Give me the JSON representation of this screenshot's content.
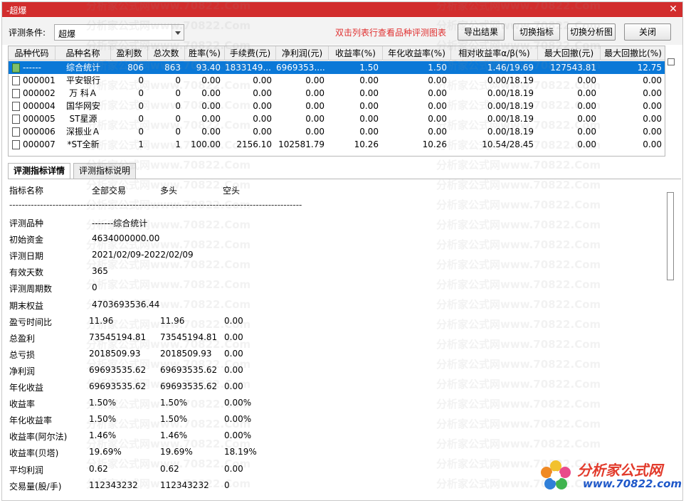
{
  "window": {
    "title": "-超爆",
    "close_label": "✕"
  },
  "toolbar": {
    "condition_label": "评测条件:",
    "condition_value": "超爆",
    "hint": "双击列表行查看品种评测图表",
    "buttons": [
      "导出结果",
      "切换指标",
      "切换分析图",
      "关闭"
    ]
  },
  "grid": {
    "columns": [
      "品种代码",
      "品种名称",
      "盈利数",
      "总次数",
      "胜率(%)",
      "手续费(元)",
      "净利润(元)",
      "收益率(%)",
      "年化收益率(%)",
      "相对收益率α/β(%)",
      "最大回撤(元)",
      "最大回撤比(%)"
    ],
    "rows": [
      [
        "------",
        "综合统计",
        "806",
        "863",
        "93.40",
        "1833149....",
        "6969353....",
        "1.50",
        "1.50",
        "1.46/19.69",
        "127543.81",
        "12.75"
      ],
      [
        "000001",
        "平安银行",
        "0",
        "0",
        "0.00",
        "0.00",
        "0.00",
        "0.00",
        "0.00",
        "0.00/18.19",
        "0.00",
        "0.00"
      ],
      [
        "000002",
        "万 科Ａ",
        "0",
        "0",
        "0.00",
        "0.00",
        "0.00",
        "0.00",
        "0.00",
        "0.00/18.19",
        "0.00",
        "0.00"
      ],
      [
        "000004",
        "国华网安",
        "0",
        "0",
        "0.00",
        "0.00",
        "0.00",
        "0.00",
        "0.00",
        "0.00/18.19",
        "0.00",
        "0.00"
      ],
      [
        "000005",
        "ST星源",
        "0",
        "0",
        "0.00",
        "0.00",
        "0.00",
        "0.00",
        "0.00",
        "0.00/18.19",
        "0.00",
        "0.00"
      ],
      [
        "000006",
        "深振业Ａ",
        "0",
        "0",
        "0.00",
        "0.00",
        "0.00",
        "0.00",
        "0.00",
        "0.00/18.19",
        "0.00",
        "0.00"
      ],
      [
        "000007",
        "*ST全新",
        "1",
        "1",
        "100.00",
        "2156.10",
        "102581.79",
        "10.26",
        "10.26",
        "10.54/28.45",
        "0.00",
        "0.00"
      ]
    ],
    "selected_row": 0
  },
  "tabs": [
    "评测指标详情",
    "评测指标说明"
  ],
  "detail": {
    "header": [
      "指标名称",
      "全部交易",
      "多头",
      "空头"
    ],
    "dashes": "-----------------------------------------------------------------------------------------------",
    "items": [
      [
        "评测品种",
        "-------综合统计",
        "",
        ""
      ],
      [
        "初始资金",
        "4634000000.00",
        "",
        ""
      ],
      [
        "评测日期",
        "2021/02/09-2022/02/09",
        "",
        ""
      ],
      [
        "有效天数",
        "365",
        "",
        ""
      ],
      [
        "评测周期数",
        "0",
        "",
        ""
      ],
      [
        "期末权益",
        "4703693536.44",
        "",
        ""
      ],
      [
        "盈亏时间比",
        "11.96",
        "11.96",
        "0.00"
      ],
      [
        "总盈利",
        "73545194.81",
        "73545194.81",
        "0.00"
      ],
      [
        "总亏损",
        "2018509.93",
        "2018509.93",
        "0.00"
      ],
      [
        "净利润",
        "69693535.62",
        "69693535.62",
        "0.00"
      ],
      [
        "年化收益",
        "69693535.62",
        "69693535.62",
        "0.00"
      ],
      [
        "收益率",
        "1.50%",
        "1.50%",
        "0.00%"
      ],
      [
        "年化收益率",
        "1.50%",
        "1.50%",
        "0.00%"
      ],
      [
        "收益率(阿尔法)",
        "1.46%",
        "1.46%",
        "0.00%"
      ],
      [
        "收益率(贝塔)",
        "19.69%",
        "19.69%",
        "18.19%"
      ],
      [
        "平均利润",
        "0.62",
        "0.62",
        "0.00"
      ],
      [
        "交易量(股/手)",
        "112343232",
        "112343232",
        "0"
      ]
    ]
  },
  "watermark": "分析家公式网www.70822.Com",
  "logo": {
    "line1": "分析家公式网",
    "line2": "www.70822.com"
  }
}
